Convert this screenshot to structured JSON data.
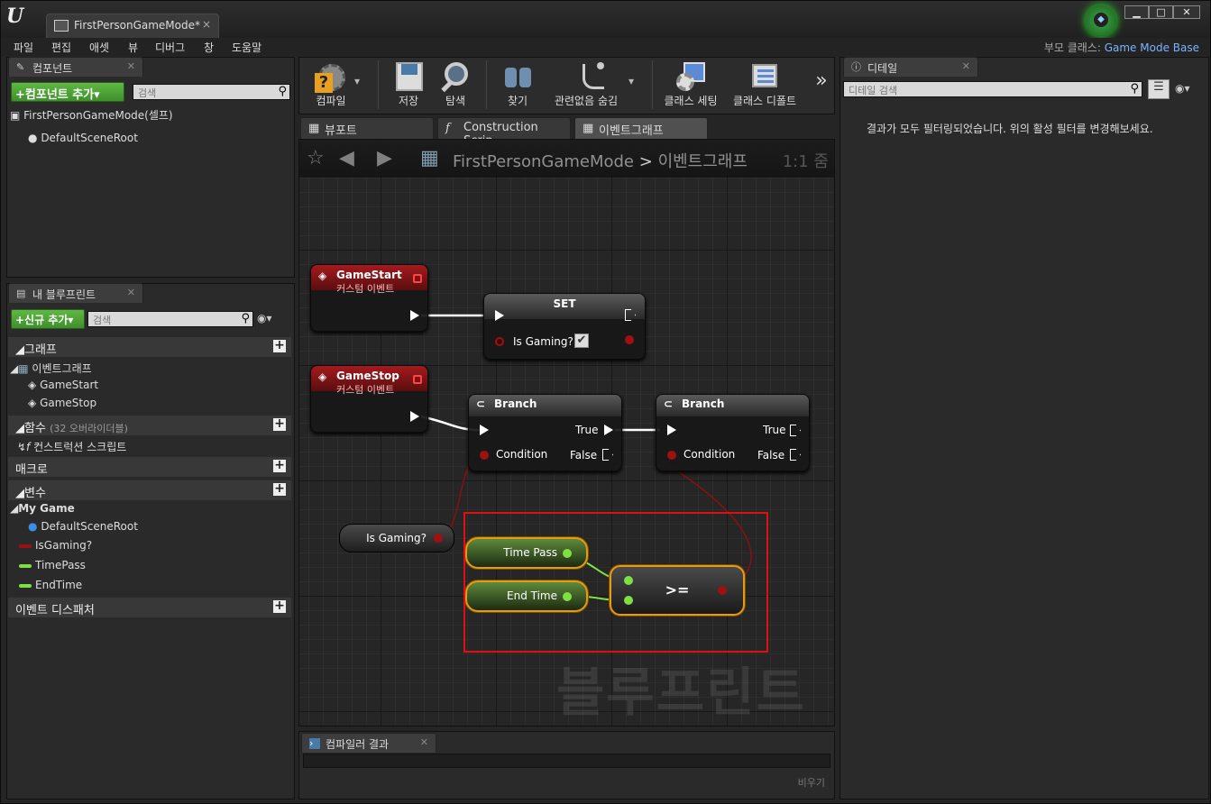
{
  "title": {
    "logo": "U",
    "doc_tab": "FirstPersonGameMode*",
    "doc_close": "×",
    "min": "▁",
    "max": "□",
    "close": "✕"
  },
  "menu": [
    "파일",
    "편집",
    "애셋",
    "뷰",
    "디버그",
    "창",
    "도움말"
  ],
  "parent_class": {
    "label": "부모 클래스:",
    "value": "Game Mode Base"
  },
  "components": {
    "tab": "컴포넌트",
    "add_button": "+컴포넌트 추가▾",
    "search_placeholder": "검색",
    "root": "FirstPersonGameMode(셀프)",
    "child": "DefaultSceneRoot"
  },
  "my_blueprint": {
    "tab": "내 블루프린트",
    "add_button": "+신규 추가▾",
    "search_placeholder": "검색",
    "graphs_cat": "그래프",
    "event_graph": "이벤트그래프",
    "events": [
      "GameStart",
      "GameStop"
    ],
    "functions_cat": "함수",
    "functions_note": "(32 오버라이더블)",
    "construction": "컨스트럭션 스크립트",
    "macros_cat": "매크로",
    "variables_cat": "변수",
    "var_group": "My Game",
    "variables": [
      {
        "name": "DefaultSceneRoot",
        "color": "#3a8ee6"
      },
      {
        "name": "IsGaming?",
        "color": "#9c1010"
      },
      {
        "name": "TimePass",
        "color": "#7fe041"
      },
      {
        "name": "EndTime",
        "color": "#7fe041"
      }
    ],
    "dispatchers_cat": "이벤트 디스패처"
  },
  "toolbar": {
    "compile": "컴파일",
    "save": "저장",
    "browse": "탐색",
    "find": "찾기",
    "hide_unrelated": "관련없음 숨김",
    "class_settings": "클래스 세팅",
    "class_defaults": "클래스 디폴트",
    "more": "»"
  },
  "graph_tabs": [
    "뷰포트",
    "Construction Scrip",
    "이벤트그래프"
  ],
  "graph": {
    "breadcrumb_root": "FirstPersonGameMode",
    "breadcrumb_sep": ">",
    "breadcrumb_leaf": "이벤트그래프",
    "zoom": "1:1 줌",
    "watermark": "블루프린트",
    "nodes": {
      "gamestart": {
        "title": "GameStart",
        "sub": "커스텀 이벤트"
      },
      "gamestop": {
        "title": "GameStop",
        "sub": "커스텀 이벤트"
      },
      "set": {
        "title": "SET",
        "pin": "Is Gaming?"
      },
      "branch1": {
        "title": "Branch",
        "cond": "Condition",
        "t": "True",
        "f": "False"
      },
      "branch2": {
        "title": "Branch",
        "cond": "Condition",
        "t": "True",
        "f": "False"
      },
      "isgaming": "Is Gaming?",
      "timepass": "Time Pass",
      "endtime": "End Time",
      "compare": ">="
    }
  },
  "details": {
    "tab": "디테일",
    "search_placeholder": "디테일 검색",
    "message": "결과가 모두 필터링되었습니다. 위의 활성 필터를 변경해보세요."
  },
  "compiler": {
    "tab": "컴파일러 결과",
    "clear": "비우기"
  }
}
